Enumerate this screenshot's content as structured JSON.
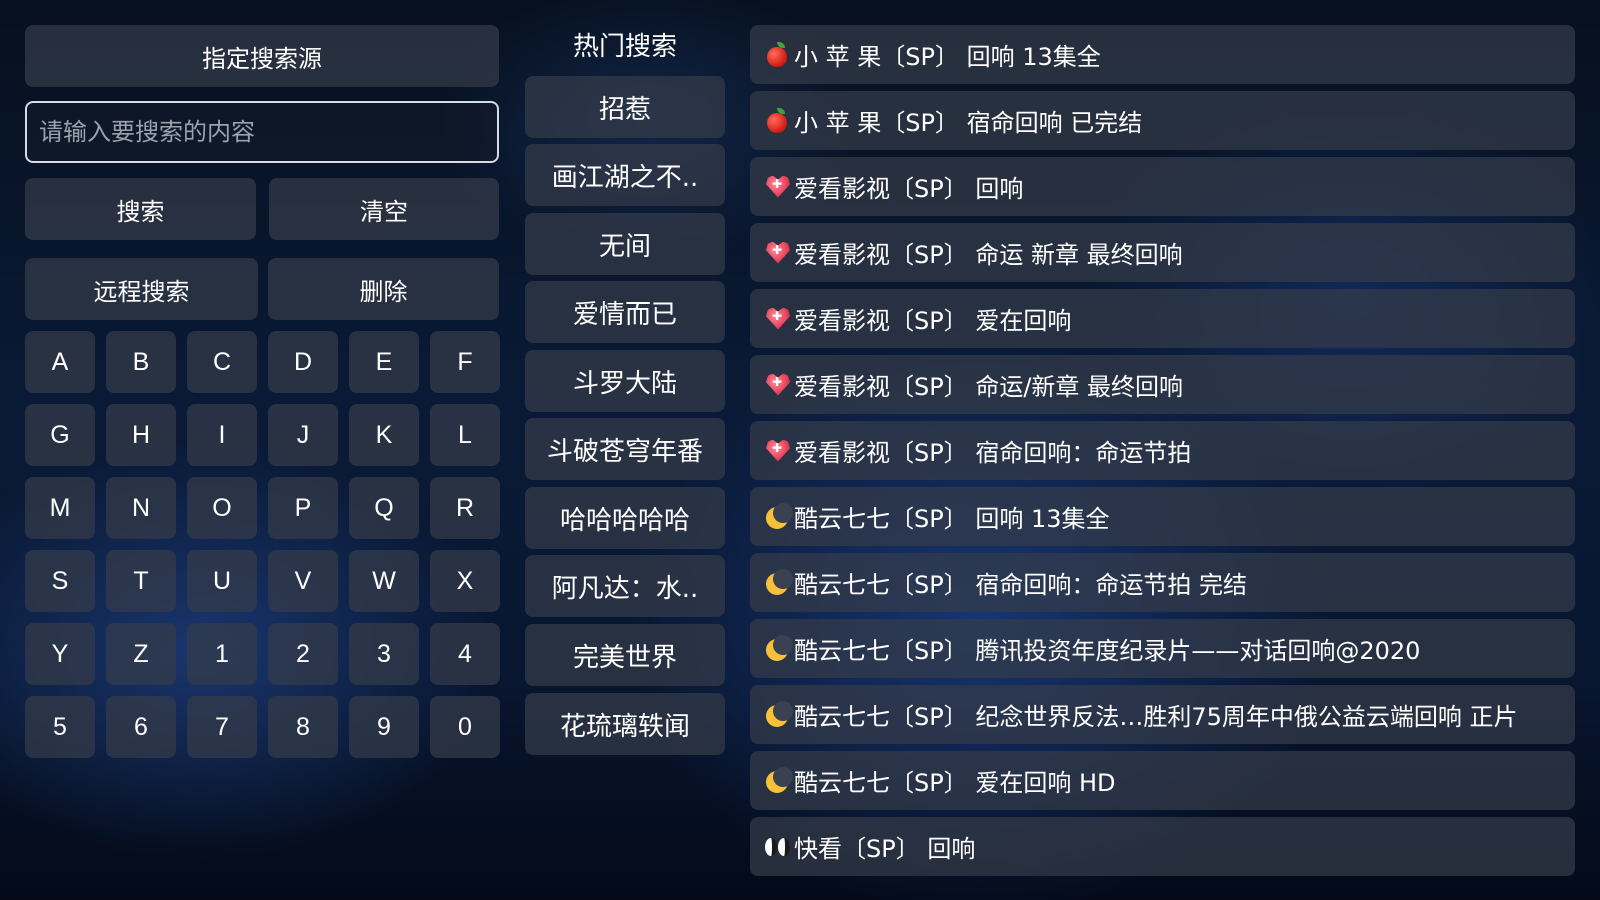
{
  "left_panel": {
    "source_button": "指定搜索源",
    "search_placeholder": "请输入要搜索的内容",
    "search_value": "",
    "search_button": "搜索",
    "clear_button": "清空",
    "remote_search_button": "远程搜索",
    "delete_button": "删除",
    "keys": [
      "A",
      "B",
      "C",
      "D",
      "E",
      "F",
      "G",
      "H",
      "I",
      "J",
      "K",
      "L",
      "M",
      "N",
      "O",
      "P",
      "Q",
      "R",
      "S",
      "T",
      "U",
      "V",
      "W",
      "X",
      "Y",
      "Z",
      "1",
      "2",
      "3",
      "4",
      "5",
      "6",
      "7",
      "8",
      "9",
      "0"
    ]
  },
  "hot_search": {
    "title": "热门搜索",
    "items": [
      "招惹",
      "画江湖之不..",
      "无间",
      "爱情而已",
      "斗罗大陆",
      "斗破苍穹年番",
      "哈哈哈哈哈",
      "阿凡达：水..",
      "完美世界",
      "花琉璃轶闻"
    ]
  },
  "results": [
    {
      "icon": "apple-icon",
      "text": "小 苹 果〔SP〕 回响 13集全"
    },
    {
      "icon": "apple-icon",
      "text": "小 苹 果〔SP〕 宿命回响 已完结"
    },
    {
      "icon": "heart-icon",
      "text": "爱看影视〔SP〕 回响"
    },
    {
      "icon": "heart-icon",
      "text": "爱看影视〔SP〕 命运 新章 最终回响"
    },
    {
      "icon": "heart-icon",
      "text": "爱看影视〔SP〕 爱在回响"
    },
    {
      "icon": "heart-icon",
      "text": "爱看影视〔SP〕 命运/新章 最终回响"
    },
    {
      "icon": "heart-icon",
      "text": "爱看影视〔SP〕 宿命回响：命运节拍"
    },
    {
      "icon": "moon-icon",
      "text": "酷云七七〔SP〕 回响 13集全"
    },
    {
      "icon": "moon-icon",
      "text": "酷云七七〔SP〕 宿命回响：命运节拍 完结"
    },
    {
      "icon": "moon-icon",
      "text": "酷云七七〔SP〕 腾讯投资年度纪录片——对话回响@2020"
    },
    {
      "icon": "moon-icon",
      "text": "酷云七七〔SP〕 纪念世界反法…胜利75周年中俄公益云端回响 正片"
    },
    {
      "icon": "moon-icon",
      "text": "酷云七七〔SP〕 爱在回响 HD"
    },
    {
      "icon": "eyes-icon",
      "text": "快看〔SP〕 回响"
    }
  ]
}
